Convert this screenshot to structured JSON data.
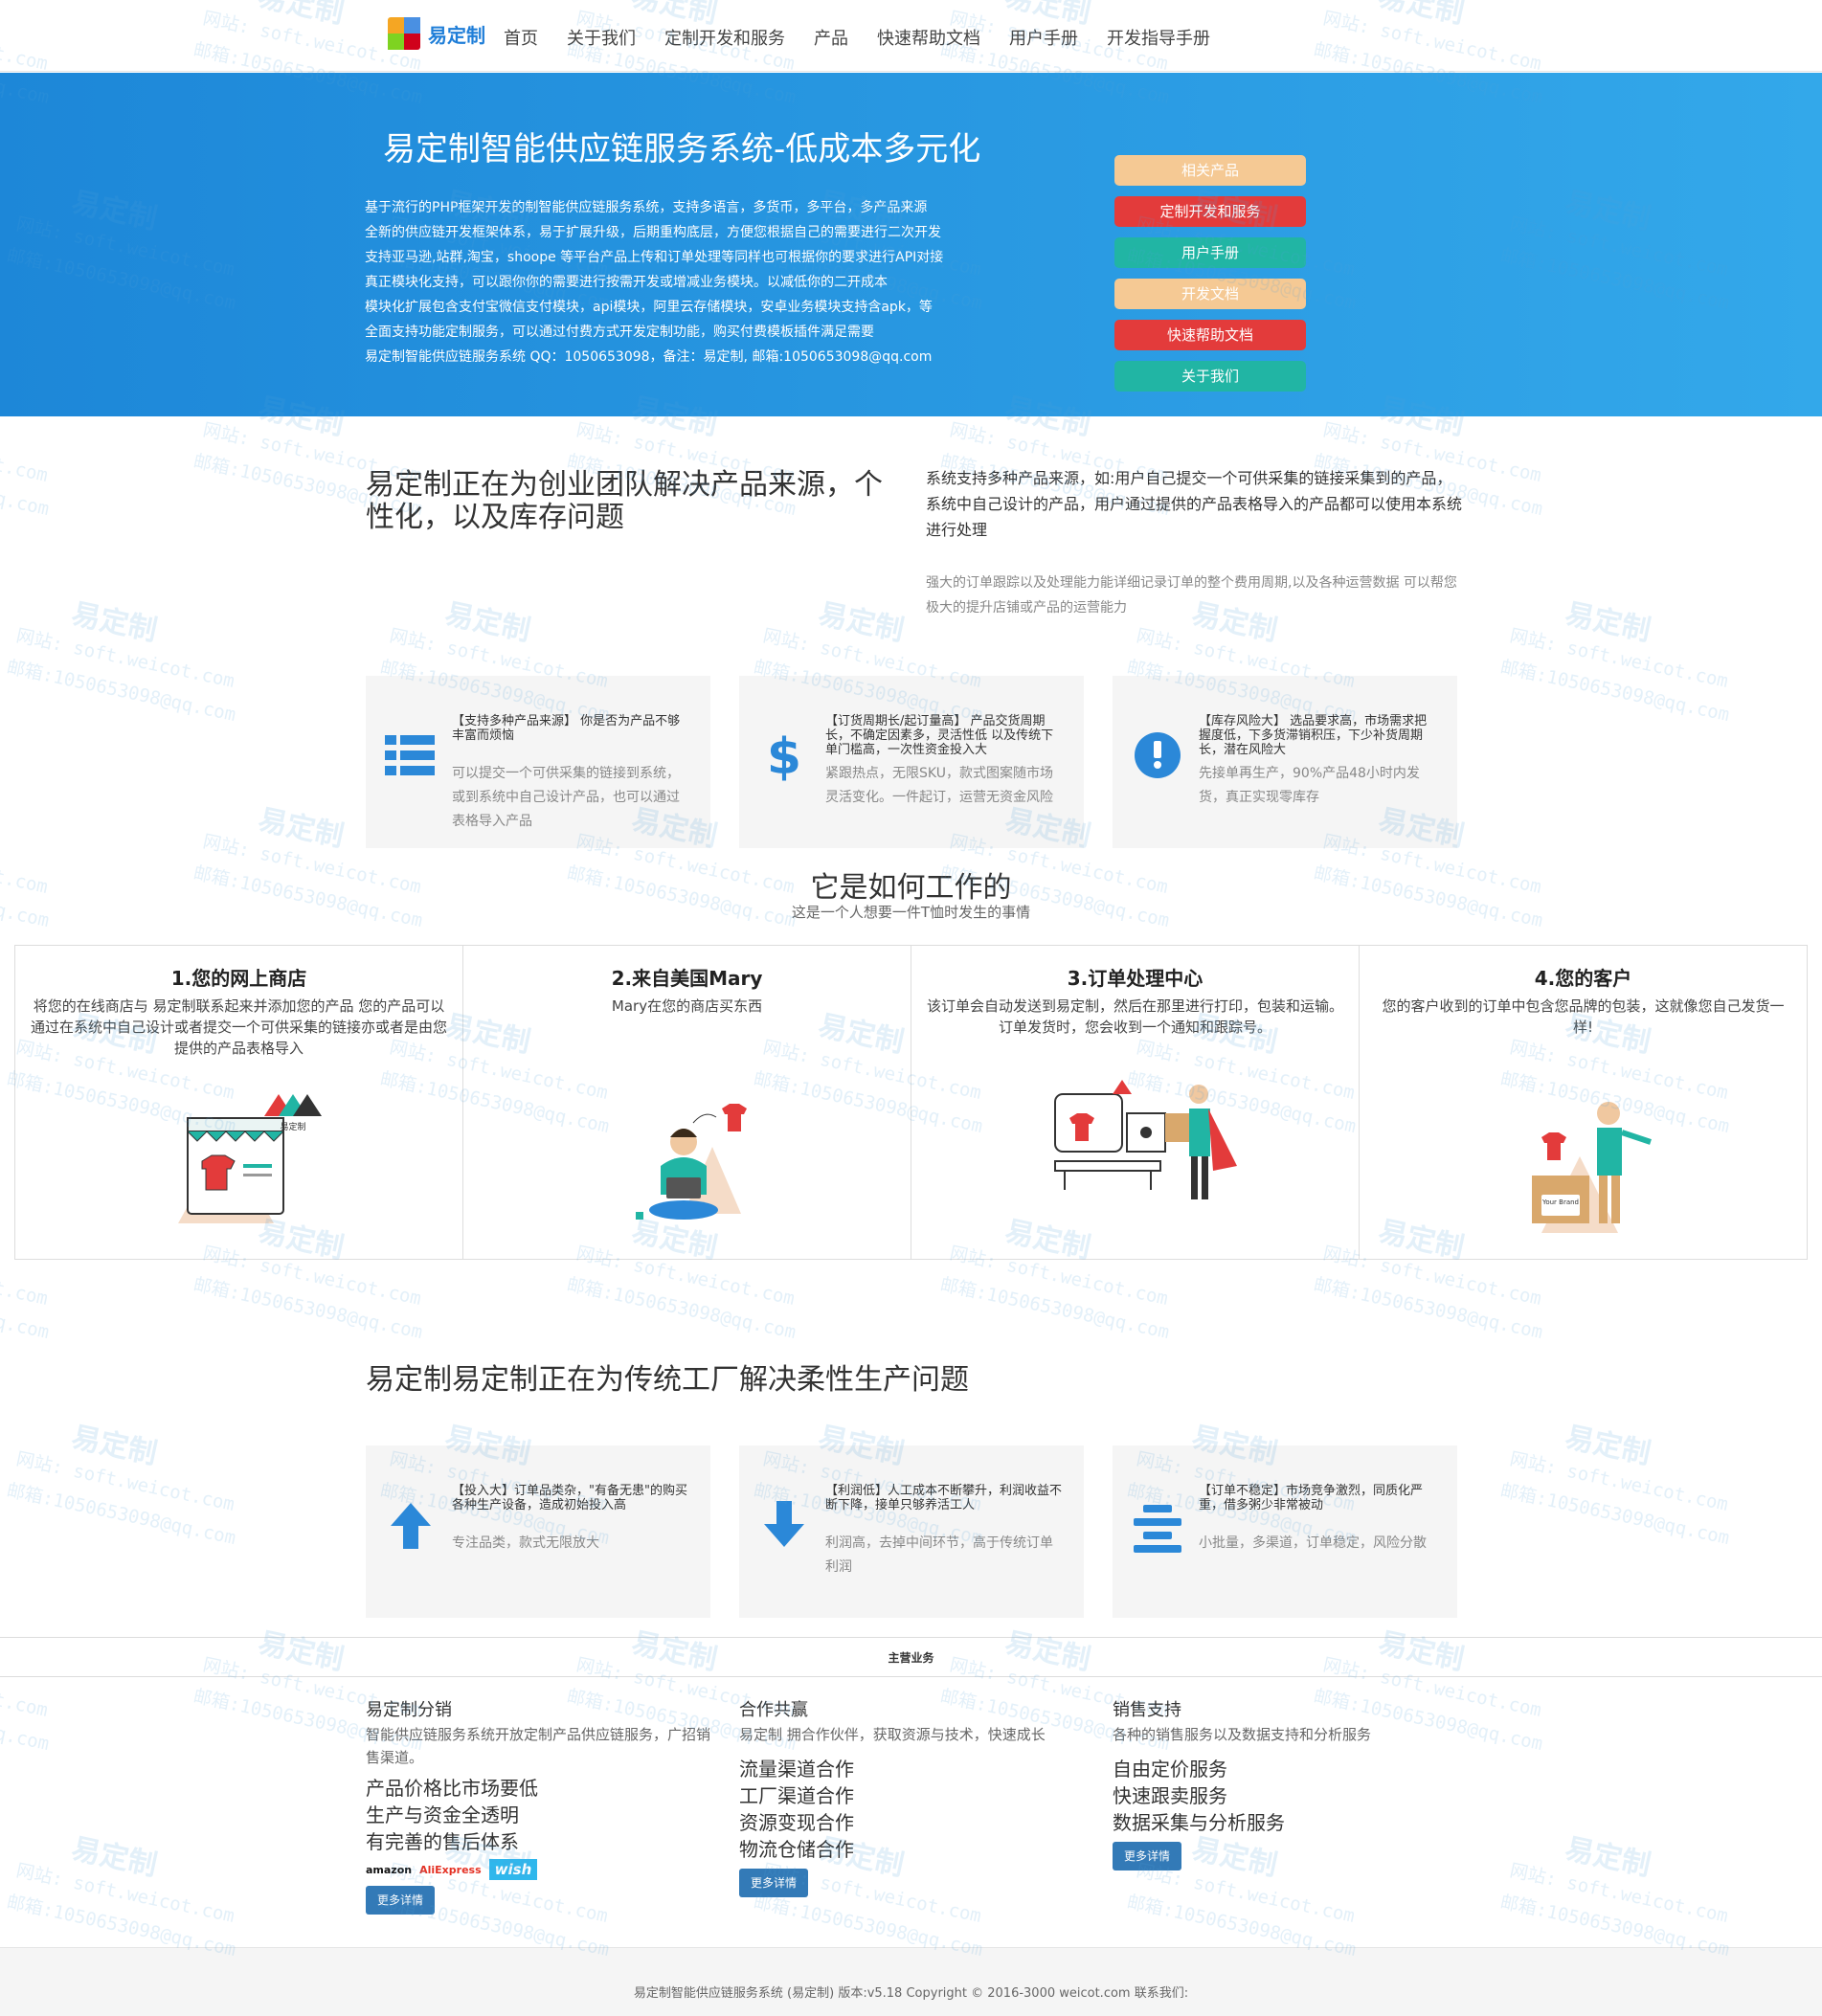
{
  "nav": {
    "logo_text": "易定制",
    "items": [
      "首页",
      "关于我们",
      "定制开发和服务",
      "产品",
      "快速帮助文档",
      "用户手册",
      "开发指导手册"
    ]
  },
  "hero": {
    "title": "易定制智能供应链服务系统-低成本多元化",
    "lines": [
      "基于流行的PHP框架开发的制智能供应链服务系统，支持多语言，多货币，多平台，多产品来源",
      "全新的供应链开发框架体系，易于扩展升级，后期重构底层，方便您根据自己的需要进行二次开发",
      "支持亚马逊,站群,淘宝，shoope 等平台产品上传和订单处理等同样也可根据你的要求进行API对接",
      "真正模块化支持，可以跟你你的需要进行按需开发或增减业务模块。以减低你的二开成本",
      "模块化扩展包含支付宝微信支付模块，api模块，阿里云存储模块，安卓业务模块支持含apk，等",
      "全面支持功能定制服务，可以通过付费方式开发定制功能，购买付费模板插件满足需要",
      "易定制智能供应链服务系统 QQ：1050653098，备注：易定制, 邮箱:1050653098@qq.com"
    ],
    "buttons": [
      {
        "label": "相关产品",
        "color": "#f5c994"
      },
      {
        "label": "定制开发和服务",
        "color": "#e33b3b"
      },
      {
        "label": "用户手册",
        "color": "#21b5a4"
      },
      {
        "label": "开发文档",
        "color": "#f5c994"
      },
      {
        "label": "快速帮助文档",
        "color": "#e33b3b"
      },
      {
        "label": "关于我们",
        "color": "#21b5a4"
      }
    ]
  },
  "intro": {
    "heading": "易定制正在为创业团队解决产品来源，个性化，以及库存问题",
    "para1": "系统支持多种产品来源，如:用户自己提交一个可供采集的链接采集到的产品，系统中自己设计的产品，用户通过提供的产品表格导入的产品都可以使用本系统进行处理",
    "para2": "强大的订单跟踪以及处理能力能详细记录订单的整个费用周期,以及各种运营数据 可以帮您极大的提升店铺或产品的运营能力"
  },
  "features": [
    {
      "icon": "list-icon",
      "title": "【支持多种产品来源】 你是否为产品不够丰富而烦恼",
      "desc": "可以提交一个可供采集的链接到系统，或到系统中自己设计产品，也可以通过表格导入产品"
    },
    {
      "icon": "dollar-icon",
      "title": "【订货周期长/起订量高】 产品交货周期长，不确定因素多，灵活性低 以及传统下单门槛高，一次性资金投入大",
      "desc": "紧跟热点，无限SKU，款式图案随市场灵活变化。一件起订，运营无资金风险"
    },
    {
      "icon": "exclamation-icon",
      "title": "【库存风险大】 选品要求高，市场需求把握度低，下多货滞销积压，下少补货周期长，潜在风险大",
      "desc": "先接单再生产，90%产品48小时内发货，真正实现零库存"
    }
  ],
  "how": {
    "title": "它是如何工作的",
    "subtitle": "这是一个人想要一件T恤时发生的事情",
    "steps": [
      {
        "title": "1.您的网上商店",
        "desc": "将您的在线商店与 易定制联系起来并添加您的产品 您的产品可以通过在系统中自己设计或者提交一个可供采集的链接亦或者是由您提供的产品表格导入",
        "brand_label": "易定制"
      },
      {
        "title": "2.来自美国Mary",
        "desc": "Mary在您的商店买东西"
      },
      {
        "title": "3.订单处理中心",
        "desc": "该订单会自动发送到易定制，然后在那里进行打印，包装和运输。订单发货时，您会收到一个通知和跟踪号。"
      },
      {
        "title": "4.您的客户",
        "desc": "您的客户收到的订单中包含您品牌的包装，这就像您自己发货一样!",
        "box_label": "Your Brand"
      }
    ]
  },
  "factory": {
    "heading": "易定制易定制正在为传统工厂解决柔性生产问题",
    "cards": [
      {
        "icon": "arrow-up-icon",
        "title": "【投入大】订单品类杂，\"有备无患\"的购买各种生产设备，造成初始投入高",
        "desc": "专注品类，款式无限放大"
      },
      {
        "icon": "arrow-down-icon",
        "title": "【利润低】人工成本不断攀升，利润收益不断下降，接单只够养活工人",
        "desc": "利润高，去掉中间环节，高于传统订单利润"
      },
      {
        "icon": "align-icon",
        "title": "【订单不稳定】市场竞争激烈，同质化严重，借多粥少非常被动",
        "desc": "小批量，多渠道，订单稳定，风险分散"
      }
    ]
  },
  "business": {
    "band_title": "主营业务",
    "cols": [
      {
        "heading": "易定制分销",
        "desc": "智能供应链服务系统开放定制产品供应链服务，广招销售渠道。",
        "items": [
          "产品价格比市场要低",
          "生产与资金全透明",
          "有完善的售后体系"
        ],
        "brands": [
          "amazon",
          "AliExpress",
          "wish"
        ],
        "more": "更多详情"
      },
      {
        "heading": "合作共赢",
        "desc": "易定制 拥合作伙伴，获取资源与技术，快速成长",
        "items": [
          "流量渠道合作",
          "工厂渠道合作",
          "资源变现合作",
          "物流仓储合作"
        ],
        "more": "更多详情"
      },
      {
        "heading": "销售支持",
        "desc": "各种的销售服务以及数据支持和分析服务",
        "items": [
          "自由定价服务",
          "快速跟卖服务",
          "数据采集与分析服务"
        ],
        "more": "更多详情"
      }
    ]
  },
  "footer": {
    "text": "易定制智能供应链服务系统 (易定制) 版本:v5.18 Copyright © 2016-3000 weicot.com 联系我们:"
  },
  "watermark": {
    "brand": "易定制",
    "site": "网站: soft.weicot.com",
    "mail": "邮箱:1050653098@qq.com"
  }
}
